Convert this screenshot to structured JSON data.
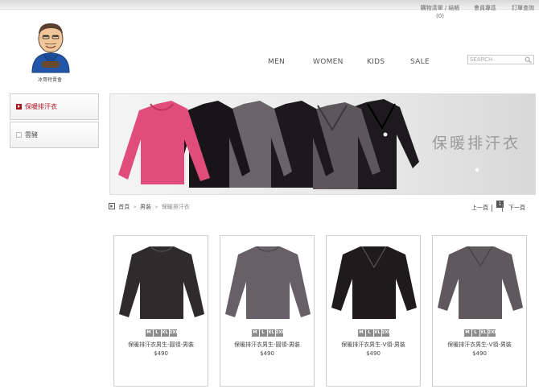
{
  "header": {
    "cart_line1": "購物清單 / 結帳",
    "cart_count": "(0)",
    "member": "會員專區",
    "order": "訂單查詢",
    "logo_name": "冰哥特賣會"
  },
  "nav": {
    "men": "MEN",
    "women": "WOMEN",
    "kids": "KIDS",
    "sale": "SALE"
  },
  "search": {
    "placeholder": "SEARCH",
    "value": ""
  },
  "sidebar": {
    "items": [
      {
        "label": "保暖排汗衣",
        "active": true
      },
      {
        "label": "雲豬",
        "active": false
      }
    ]
  },
  "banner": {
    "title": "保暖排汗衣"
  },
  "breadcrumb": {
    "home": "首頁",
    "sep": "»",
    "category": "男裝",
    "current": "保暖排汗衣"
  },
  "pager": {
    "prev": "上一頁",
    "page": "1",
    "next": "下一頁"
  },
  "products": [
    {
      "name": "保暖排汗衣男生-圓領-男裝",
      "price": "$490",
      "sizes": [
        "M",
        "L",
        "XL",
        "2XL"
      ],
      "color": "#2f2a2c"
    },
    {
      "name": "保暖排汗衣男生-圓領-男裝",
      "price": "$490",
      "sizes": [
        "M",
        "L",
        "XL",
        "2XL"
      ],
      "color": "#676066"
    },
    {
      "name": "保暖排汗衣男生-V領-男裝",
      "price": "$490",
      "sizes": [
        "M",
        "L",
        "XL",
        "2XL"
      ],
      "color": "#1f1b1d"
    },
    {
      "name": "保暖排汗衣男生-V領-男裝",
      "price": "$490",
      "sizes": [
        "M",
        "L",
        "XL",
        "2XL"
      ],
      "color": "#5f595d"
    }
  ],
  "colors": {
    "accent": "#b01020",
    "banner_pink": "#e04d7d",
    "border": "#cfcfcf"
  }
}
